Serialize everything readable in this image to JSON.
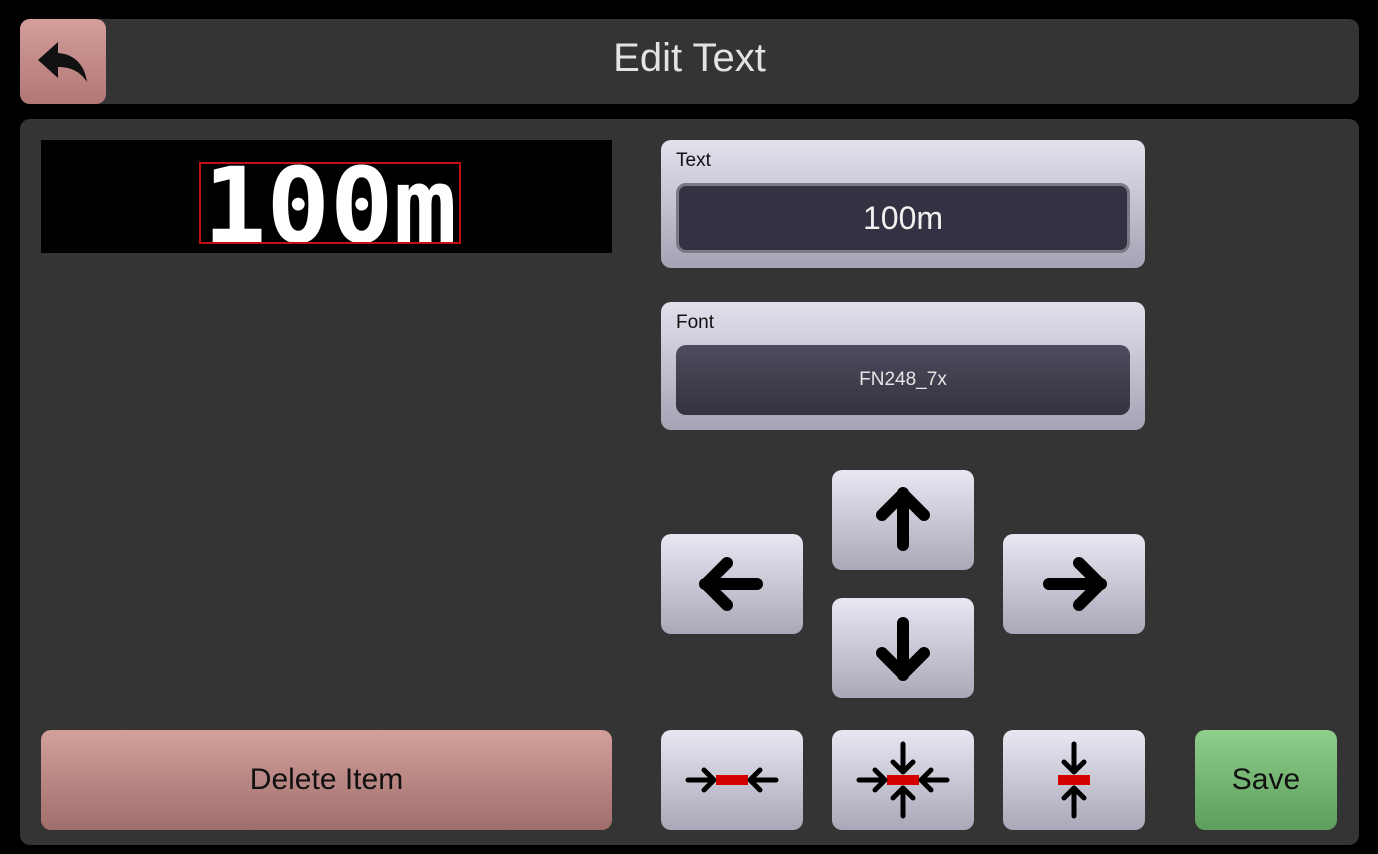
{
  "header": {
    "title": "Edit Text",
    "back_icon": "back-arrow-icon"
  },
  "preview": {
    "text": "100m",
    "text_color": "#ffffff",
    "selection_color": "#c01010"
  },
  "text_field": {
    "label": "Text",
    "value": "100m"
  },
  "font_field": {
    "label": "Font",
    "value": "FN248_7x"
  },
  "move_buttons": {
    "up_icon": "arrow-up-icon",
    "down_icon": "arrow-down-icon",
    "left_icon": "arrow-left-icon",
    "right_icon": "arrow-right-icon"
  },
  "align_buttons": {
    "center_horizontal_icon": "center-horizontal-icon",
    "center_both_icon": "center-both-icon",
    "center_vertical_icon": "center-vertical-icon"
  },
  "actions": {
    "delete_label": "Delete Item",
    "save_label": "Save"
  },
  "colors": {
    "delete": "#c08a87",
    "save": "#76b674",
    "accent_red": "#d40000"
  }
}
